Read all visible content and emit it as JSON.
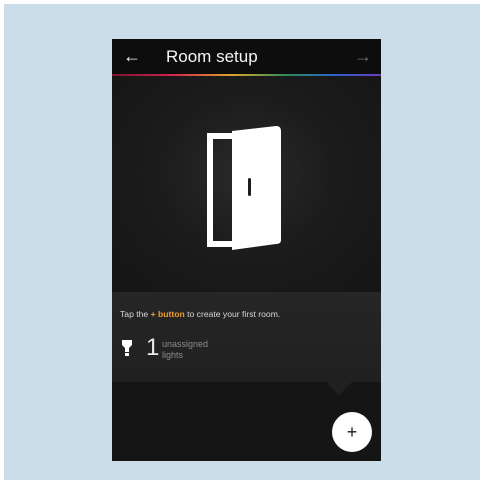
{
  "header": {
    "title": "Room setup",
    "back_icon": "←",
    "forward_icon": "→"
  },
  "hero": {
    "icon": "door-icon"
  },
  "info": {
    "hint_prefix": "Tap the ",
    "hint_accent": "+ button",
    "hint_suffix": " to create your first room.",
    "bulb_icon": "bulb-icon",
    "count": "1",
    "unassigned_label_line1": "unassigned",
    "unassigned_label_line2": "lights"
  },
  "fab": {
    "label": "+"
  },
  "colors": {
    "background_frame": "#cbdde8",
    "app_background": "#131313",
    "accent": "#f39c2b",
    "fab_background": "#ffffff"
  }
}
